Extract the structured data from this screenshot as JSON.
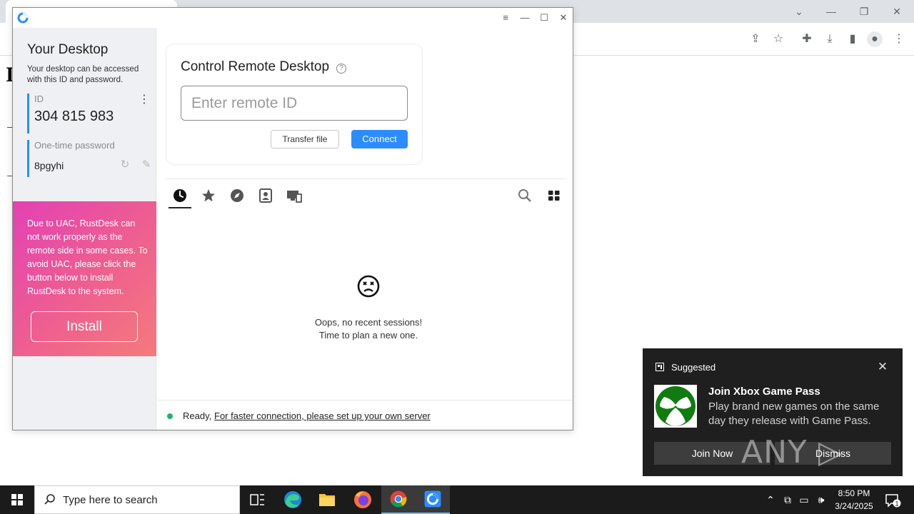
{
  "rustdesk": {
    "your_desktop_title": "Your Desktop",
    "your_desktop_desc": "Your desktop can be accessed with this ID and password.",
    "id_label": "ID",
    "id_value": "304 815 983",
    "password_label": "One-time password",
    "password_value": "8pgyhi",
    "uac_message": "Due to UAC, RustDesk can not work properly as the remote side in some cases. To avoid UAC, please click the button below to install RustDesk to the system.",
    "install_label": "Install",
    "control_title": "Control Remote Desktop",
    "remote_id_placeholder": "Enter remote ID",
    "transfer_label": "Transfer file",
    "connect_label": "Connect",
    "tabs": [
      "recent-sessions",
      "favorites",
      "discovered",
      "address-book",
      "accessible-devices"
    ],
    "empty_line1": "Oops, no recent sessions!",
    "empty_line2": "Time to plan a new one.",
    "status_ready": "Ready,",
    "status_link": "For faster connection, please set up your own server",
    "accent_color": "#2c8cff",
    "status_color": "#21b36a"
  },
  "page": {
    "snippet": "I"
  },
  "toast": {
    "header": "Suggested",
    "title": "Join Xbox Game Pass",
    "body": "Play brand new games on the same day they release with Game Pass.",
    "join_label": "Join Now",
    "dismiss_label": "Dismiss",
    "watermark": "ANY ▷ RUN"
  },
  "taskbar": {
    "search_placeholder": "Type here to search",
    "time": "8:50 PM",
    "date": "3/24/2025",
    "notification_count": "1"
  }
}
